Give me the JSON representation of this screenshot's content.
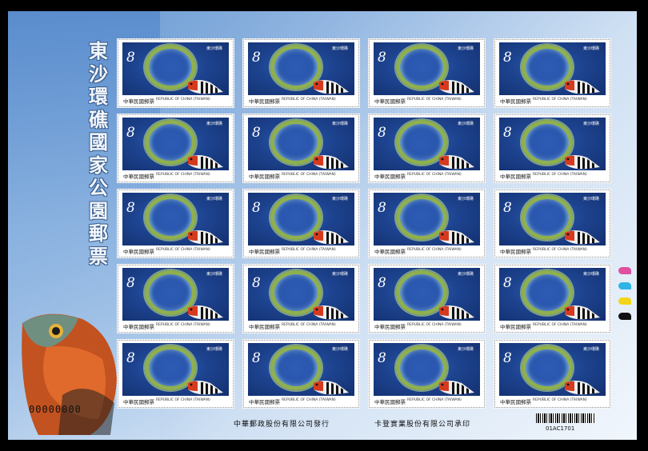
{
  "sheet": {
    "title": [
      "東",
      "沙",
      "環",
      "礁",
      "國",
      "家",
      "公",
      "園",
      "郵",
      "票"
    ],
    "serial": "00000000",
    "issuer": "中華郵政股份有限公司發行",
    "printer": "卡登實業股份有限公司承印",
    "barcode_text": "01AC1701",
    "registration_colors": [
      "#e04fa0",
      "#2fb4e6",
      "#f3d419",
      "#111111"
    ]
  },
  "stamps": {
    "rows": 5,
    "cols": 4,
    "denomination": "8",
    "park_name": "東沙環礁",
    "country_cn": "中華民國郵票",
    "country_en": "REPUBLIC OF CHINA (TAIWAN)"
  }
}
